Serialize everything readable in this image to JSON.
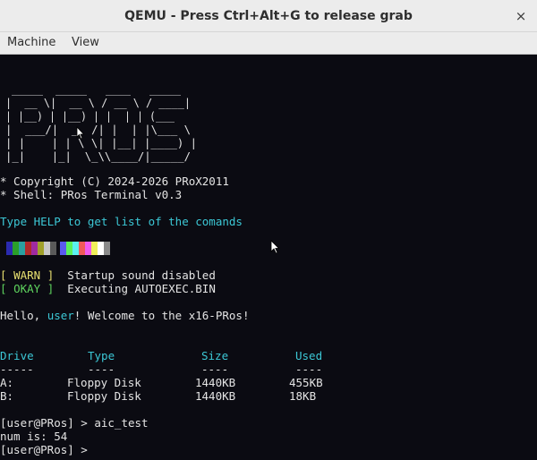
{
  "window": {
    "title": "QEMU - Press Ctrl+Alt+G to release grab",
    "close_glyph": "×"
  },
  "menu": {
    "items": [
      "Machine",
      "View"
    ]
  },
  "terminal": {
    "logo": {
      "rows": [
        " _____  _____   ____   _____",
        "|  __ \\|  __ \\ / __ \\ / ____|",
        "| |__) | |__) | |  | | (___",
        "|  ___/|  _  /| |  | |\\___ \\",
        "| |    | | \\ \\| |__| |____) |",
        "|_|    |_|  \\_\\\\____/|_____/"
      ]
    },
    "copyright": "* Copyright (C) 2024-2026 PRoX2011",
    "shell": "* Shell: PRos Terminal v0.3",
    "help_hint": "Type HELP to get list of the comands",
    "palette": {
      "dark": [
        "#2a2ab0",
        "#2aa02a",
        "#2aa0a0",
        "#b02a2a",
        "#a02aa0",
        "#a0a02a",
        "#c8c8c8",
        "#5a5a5a"
      ],
      "bright": [
        "#5a5af0",
        "#5af05a",
        "#5af0f0",
        "#f05a5a",
        "#f05af0",
        "#f0f05a",
        "#ffffff",
        "#8a8a8a"
      ]
    },
    "status": [
      {
        "tag": "WARN",
        "message": "Startup sound disabled",
        "color": "#e8e070"
      },
      {
        "tag": "OKAY",
        "message": "Executing AUTOEXEC.BIN",
        "color": "#5ed35e"
      }
    ],
    "welcome": {
      "prefix": "Hello, ",
      "user": "user",
      "suffix": "! Welcome to the x16-PRos!"
    },
    "drives_table": {
      "headers": [
        "Drive",
        "Type",
        "Size",
        "Used"
      ],
      "separators": [
        "-----",
        "----",
        "----",
        "----"
      ],
      "rows": [
        [
          "A:",
          "Floppy Disk",
          "1440KB",
          "455KB"
        ],
        [
          "B:",
          "Floppy Disk",
          "1440KB",
          "18KB"
        ]
      ]
    },
    "history": [
      "[user@PRos] > aic_test",
      "num is: 54",
      "[user@PRos] >"
    ]
  }
}
